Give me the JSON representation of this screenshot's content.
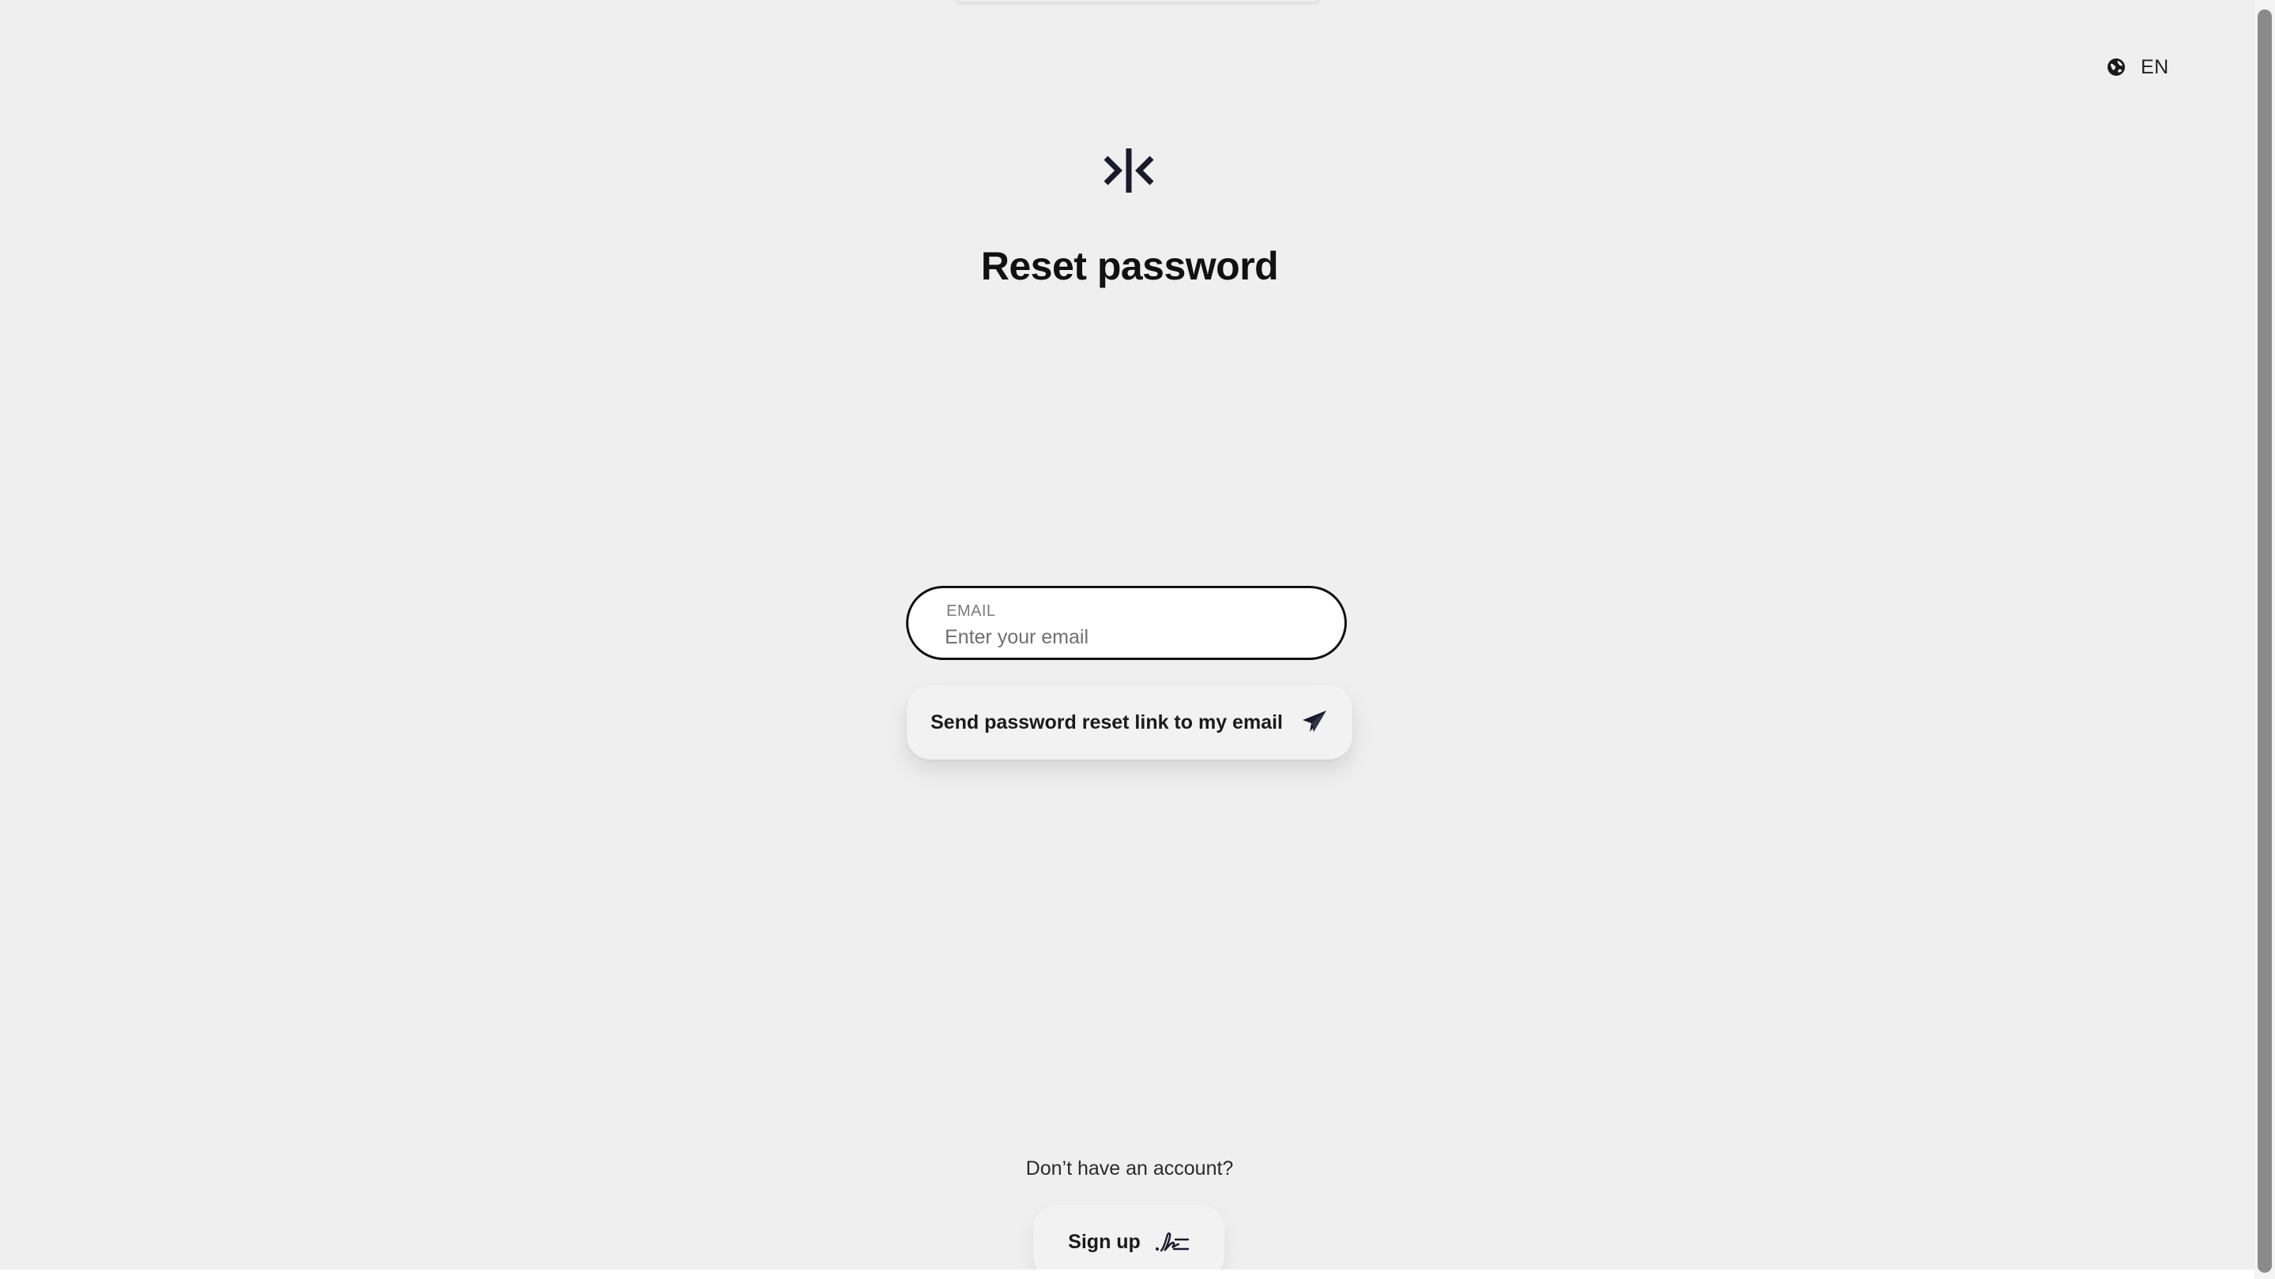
{
  "header": {
    "language": {
      "icon": "globe-icon",
      "label": "EN"
    },
    "logo": {
      "icon": "brand-logo-icon"
    }
  },
  "main": {
    "title": "Reset password",
    "email_field": {
      "label": "EMAIL",
      "value": "",
      "placeholder": "Enter your email"
    },
    "send_button": {
      "label": "Send password reset link to my email",
      "icon": "paper-plane-icon"
    }
  },
  "footer": {
    "prompt": "Don’t have an account?",
    "signup_button": {
      "label": "Sign up",
      "icon": "signature-icon"
    }
  }
}
